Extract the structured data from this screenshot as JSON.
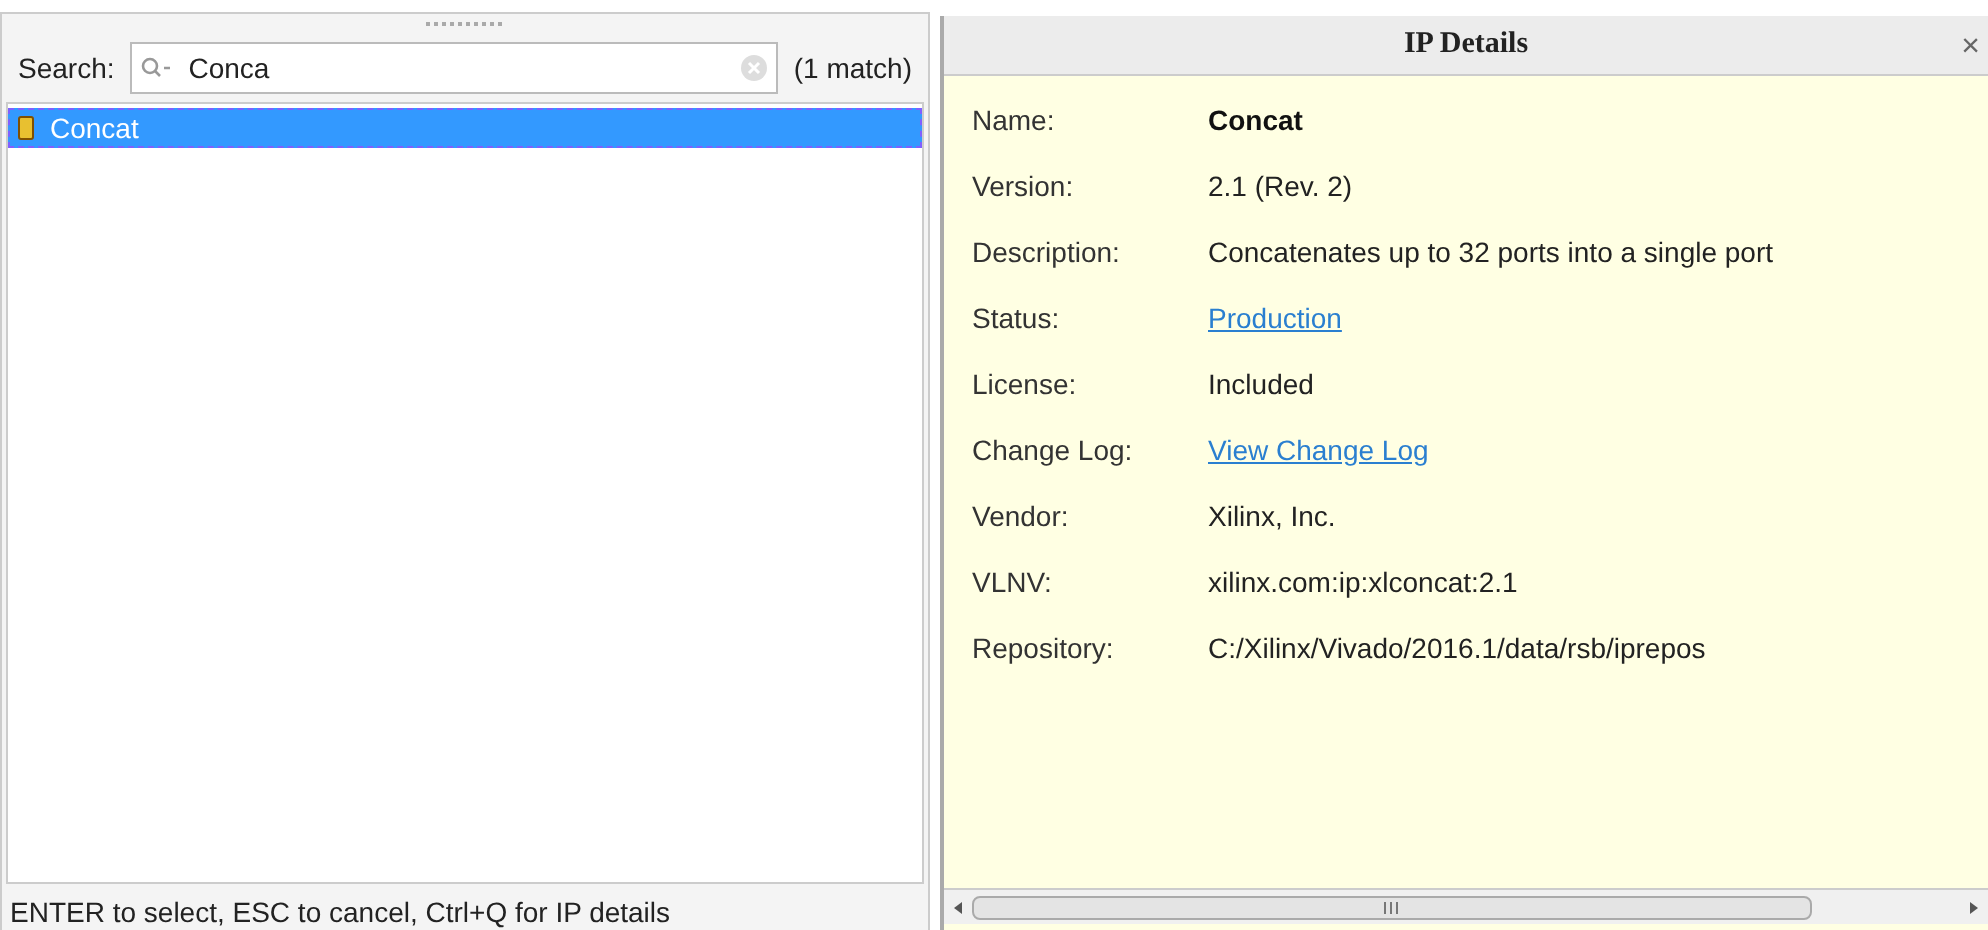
{
  "search": {
    "label": "Search:",
    "value": "Conca",
    "match_count": "(1 match)"
  },
  "results": [
    {
      "label": "Concat",
      "selected": true
    }
  ],
  "status_hint": "ENTER to select, ESC to cancel, Ctrl+Q for IP details",
  "details": {
    "title": "IP Details",
    "close": "×",
    "rows": [
      {
        "label": "Name:",
        "value": "Concat",
        "kind": "bold"
      },
      {
        "label": "Version:",
        "value": "2.1 (Rev. 2)",
        "kind": "text"
      },
      {
        "label": "Description:",
        "value": "Concatenates up to 32 ports into a single port",
        "kind": "text"
      },
      {
        "label": "Status:",
        "value": "Production",
        "kind": "link"
      },
      {
        "label": "License:",
        "value": "Included",
        "kind": "text"
      },
      {
        "label": "Change Log:",
        "value": "View Change Log",
        "kind": "link"
      },
      {
        "label": "Vendor:",
        "value": "Xilinx, Inc.",
        "kind": "text"
      },
      {
        "label": "VLNV:",
        "value": "xilinx.com:ip:xlconcat:2.1",
        "kind": "text"
      },
      {
        "label": "Repository:",
        "value": "C:/Xilinx/Vivado/2016.1/data/rsb/iprepos",
        "kind": "text"
      }
    ]
  }
}
